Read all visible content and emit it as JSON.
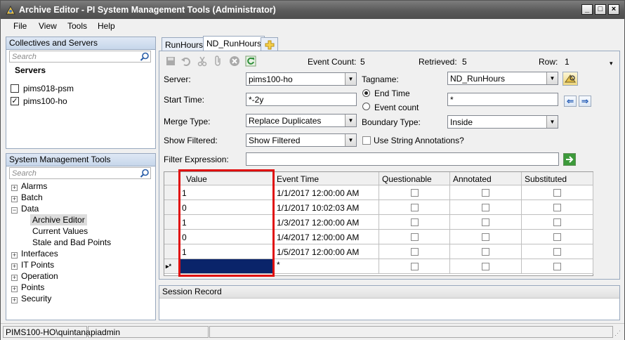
{
  "window": {
    "title": "Archive Editor - PI System Management Tools (Administrator)"
  },
  "menu": [
    "File",
    "View",
    "Tools",
    "Help"
  ],
  "collectives": {
    "header": "Collectives and Servers",
    "search_placeholder": "Search",
    "group_label": "Servers",
    "servers": [
      {
        "name": "pims018-psm",
        "checked": false
      },
      {
        "name": "pims100-ho",
        "checked": true
      }
    ]
  },
  "smt": {
    "header": "System Management Tools",
    "search_placeholder": "Search",
    "items": [
      {
        "label": "Alarms",
        "expander": "+"
      },
      {
        "label": "Batch",
        "expander": "+"
      },
      {
        "label": "Data",
        "expander": "−"
      },
      {
        "label": "Archive Editor",
        "selected": true
      },
      {
        "label": "Current Values"
      },
      {
        "label": "Stale and Bad Points"
      },
      {
        "label": "Interfaces",
        "expander": "+"
      },
      {
        "label": "IT Points",
        "expander": "+"
      },
      {
        "label": "Operation",
        "expander": "+"
      },
      {
        "label": "Points",
        "expander": "+"
      },
      {
        "label": "Security",
        "expander": "+"
      }
    ]
  },
  "tabs": [
    {
      "label": "RunHours",
      "active": false
    },
    {
      "label": "ND_RunHours",
      "active": true
    }
  ],
  "toolbar": {
    "event_count_label": "Event Count:",
    "event_count": "5",
    "retrieved_label": "Retrieved:",
    "retrieved": "5",
    "row_label": "Row:",
    "row": "1"
  },
  "form": {
    "server_label": "Server:",
    "server_value": "pims100-ho",
    "tagname_label": "Tagname:",
    "tagname_value": "ND_RunHours",
    "start_time_label": "Start Time:",
    "start_time_value": "*-2y",
    "end_time_radio": "End Time",
    "event_count_radio": "Event count",
    "end_time_value": "*",
    "merge_type_label": "Merge Type:",
    "merge_type_value": "Replace Duplicates",
    "boundary_type_label": "Boundary Type:",
    "boundary_type_value": "Inside",
    "show_filtered_label": "Show Filtered:",
    "show_filtered_value": "Show Filtered",
    "use_string_annotations": "Use String Annotations?",
    "filter_expression_label": "Filter Expression:",
    "filter_expression_value": ""
  },
  "grid": {
    "columns": [
      "Value",
      "Event Time",
      "Questionable",
      "Annotated",
      "Substituted"
    ],
    "rows": [
      {
        "value": "1",
        "time": "1/1/2017 12:00:00 AM"
      },
      {
        "value": "0",
        "time": "1/1/2017 10:02:03 AM"
      },
      {
        "value": "1",
        "time": "1/3/2017 12:00:00 AM"
      },
      {
        "value": "0",
        "time": "1/4/2017 12:00:00 AM"
      },
      {
        "value": "1",
        "time": "1/5/2017 12:00:00 AM"
      }
    ],
    "new_row_marker": "▸*",
    "new_row_time": "*"
  },
  "session": {
    "header": "Session Record"
  },
  "status": {
    "server_user": "PIMS100-HO\\quintana",
    "pi_user": "piadmin"
  },
  "colors": {
    "highlight": "#e01010",
    "selection": "#0a246a",
    "panel_border": "#98a8be"
  }
}
